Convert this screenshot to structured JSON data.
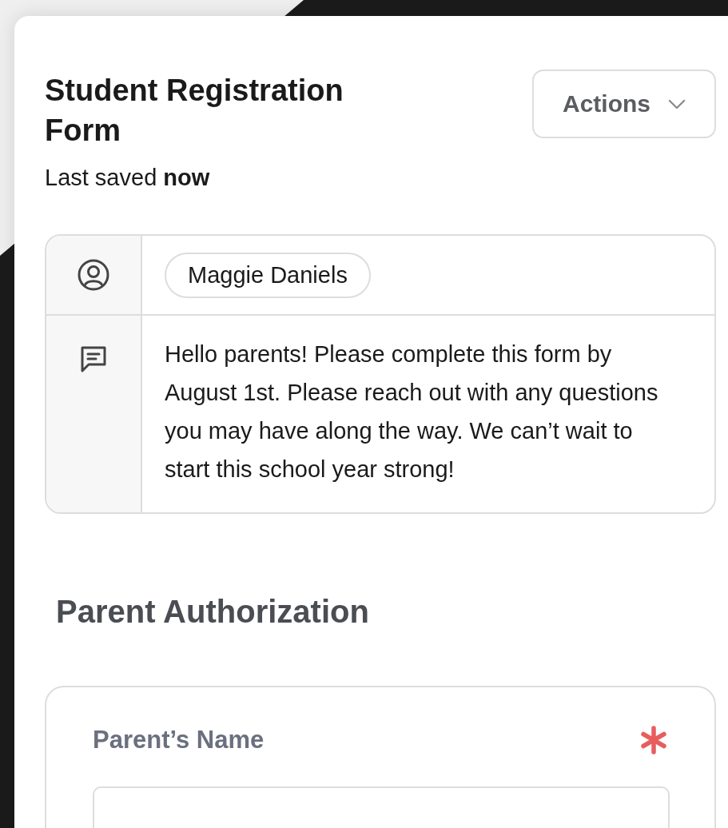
{
  "form": {
    "title": "Student Registration Form",
    "last_saved_label": "Last saved",
    "last_saved_value": "now",
    "actions_button": "Actions"
  },
  "info": {
    "author": "Maggie Daniels",
    "message": "Hello parents! Please complete this form by August 1st. Please reach out with any questions you may have along the way. We can’t wait to start this school year strong!"
  },
  "section": {
    "title": "Parent Authorization"
  },
  "fields": [
    {
      "label": "Parent’s Name",
      "required": true,
      "kind": "text"
    }
  ]
}
